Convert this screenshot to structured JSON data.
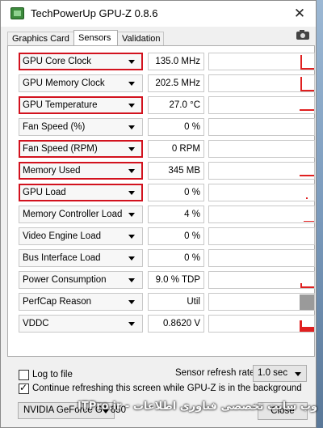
{
  "window": {
    "title": "TechPowerUp GPU-Z 0.8.6",
    "close_glyph": "✕"
  },
  "tabs": [
    {
      "label": "Graphics Card",
      "active": false
    },
    {
      "label": "Sensors",
      "active": true
    },
    {
      "label": "Validation",
      "active": false
    }
  ],
  "toolbar": {
    "camera_icon": "camera-icon"
  },
  "sensors": [
    {
      "name": "GPU Core Clock",
      "value": "135.0 MHz",
      "highlighted": true
    },
    {
      "name": "GPU Memory Clock",
      "value": "202.5 MHz",
      "highlighted": false
    },
    {
      "name": "GPU Temperature",
      "value": "27.0 °C",
      "highlighted": true
    },
    {
      "name": "Fan Speed (%)",
      "value": "0 %",
      "highlighted": false
    },
    {
      "name": "Fan Speed (RPM)",
      "value": "0 RPM",
      "highlighted": true
    },
    {
      "name": "Memory Used",
      "value": "345 MB",
      "highlighted": true
    },
    {
      "name": "GPU Load",
      "value": "0 %",
      "highlighted": true
    },
    {
      "name": "Memory Controller Load",
      "value": "4 %",
      "highlighted": false
    },
    {
      "name": "Video Engine Load",
      "value": "0 %",
      "highlighted": false
    },
    {
      "name": "Bus Interface Load",
      "value": "0 %",
      "highlighted": false
    },
    {
      "name": "Power Consumption",
      "value": "9.0 % TDP",
      "highlighted": false
    },
    {
      "name": "PerfCap Reason",
      "value": "Util",
      "highlighted": false
    },
    {
      "name": "VDDC",
      "value": "0.8620 V",
      "highlighted": false
    }
  ],
  "footer": {
    "log_to_file_label": "Log to file",
    "log_to_file_checked": false,
    "continue_refresh_label": "Continue refreshing this screen while GPU-Z is in the background",
    "continue_refresh_checked": true,
    "refresh_rate_label": "Sensor refresh rate:",
    "refresh_rate_value": "1.0 sec",
    "gpu_select_value": "NVIDIA GeForce GT 650",
    "close_label": "Close"
  },
  "watermark": {
    "text": "وب سایت تخصصی فناوری اطلاعات - ITPro.ir"
  },
  "colors": {
    "highlight": "#d2121e",
    "graph": "#e02020"
  }
}
